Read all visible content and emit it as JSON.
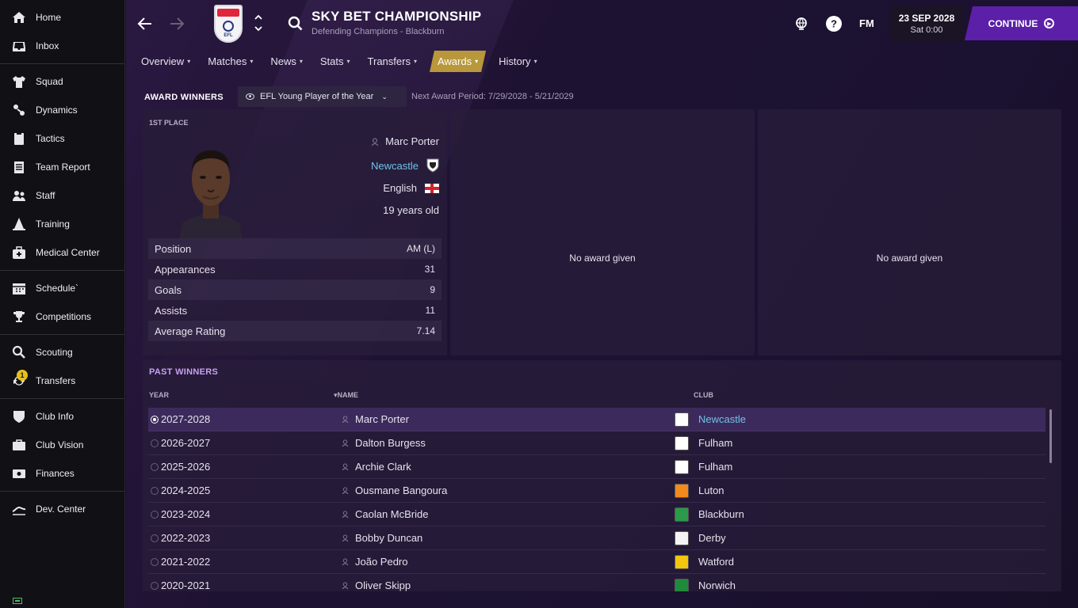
{
  "sidebar": {
    "groups": [
      [
        {
          "label": "Home",
          "icon": "home-icon"
        },
        {
          "label": "Inbox",
          "icon": "inbox-icon"
        }
      ],
      [
        {
          "label": "Squad",
          "icon": "shirt-icon"
        },
        {
          "label": "Dynamics",
          "icon": "dynamics-icon"
        },
        {
          "label": "Tactics",
          "icon": "tactics-board-icon"
        },
        {
          "label": "Team Report",
          "icon": "report-icon"
        },
        {
          "label": "Staff",
          "icon": "staff-icon"
        },
        {
          "label": "Training",
          "icon": "training-cone-icon"
        },
        {
          "label": "Medical Center",
          "icon": "medical-kit-icon"
        }
      ],
      [
        {
          "label": "Schedule`",
          "icon": "calendar-icon"
        },
        {
          "label": "Competitions",
          "icon": "trophy-icon"
        }
      ],
      [
        {
          "label": "Scouting",
          "icon": "magnifier-icon"
        },
        {
          "label": "Transfers",
          "icon": "transfers-icon",
          "badge": "1"
        }
      ],
      [
        {
          "label": "Club Info",
          "icon": "shield-icon"
        },
        {
          "label": "Club Vision",
          "icon": "briefcase-icon"
        },
        {
          "label": "Finances",
          "icon": "money-icon"
        }
      ],
      [
        {
          "label": "Dev. Center",
          "icon": "dev-center-icon"
        }
      ]
    ]
  },
  "header": {
    "title": "SKY BET CHAMPIONSHIP",
    "subtitle": "Defending Champions - Blackburn",
    "fm_label": "FM",
    "date": "23 SEP 2028",
    "time": "Sat 0:00",
    "continue_label": "CONTINUE"
  },
  "tabs": [
    {
      "label": "Overview",
      "active": false
    },
    {
      "label": "Matches",
      "active": false
    },
    {
      "label": "News",
      "active": false
    },
    {
      "label": "Stats",
      "active": false
    },
    {
      "label": "Transfers",
      "active": false
    },
    {
      "label": "Awards",
      "active": true
    },
    {
      "label": "History",
      "active": false
    }
  ],
  "award": {
    "section_title": "AWARD WINNERS",
    "selected_award": "EFL Young Player of the Year",
    "next_period": "Next Award Period: 7/29/2028 - 5/21/2029",
    "first_place_label": "1ST PLACE",
    "player": {
      "name": "Marc Porter",
      "club": "Newcastle",
      "nationality": "English",
      "age": "19 years old"
    },
    "stats": [
      {
        "label": "Position",
        "value": "AM (L)"
      },
      {
        "label": "Appearances",
        "value": "31"
      },
      {
        "label": "Goals",
        "value": "9"
      },
      {
        "label": "Assists",
        "value": "11"
      },
      {
        "label": "Average Rating",
        "value": "7.14"
      }
    ],
    "second_panel": "No award given",
    "third_panel": "No award given"
  },
  "past_winners": {
    "title": "PAST WINNERS",
    "columns": {
      "year": "YEAR",
      "name": "NAME",
      "club": "CLUB"
    },
    "rows": [
      {
        "year": "2027-2028",
        "name": "Marc Porter",
        "club": "Newcastle",
        "badge_color": "#ffffff",
        "selected": true,
        "club_link": true
      },
      {
        "year": "2026-2027",
        "name": "Dalton Burgess",
        "club": "Fulham",
        "badge_color": "#ffffff",
        "selected": false,
        "club_link": false
      },
      {
        "year": "2025-2026",
        "name": "Archie Clark",
        "club": "Fulham",
        "badge_color": "#ffffff",
        "selected": false,
        "club_link": false
      },
      {
        "year": "2024-2025",
        "name": "Ousmane Bangoura",
        "club": "Luton",
        "badge_color": "#f28a1e",
        "selected": false,
        "club_link": false
      },
      {
        "year": "2023-2024",
        "name": "Caolan McBride",
        "club": "Blackburn",
        "badge_color": "#2a9a4a",
        "selected": false,
        "club_link": false
      },
      {
        "year": "2022-2023",
        "name": "Bobby Duncan",
        "club": "Derby",
        "badge_color": "#f4f4f4",
        "selected": false,
        "club_link": false
      },
      {
        "year": "2021-2022",
        "name": "João Pedro",
        "club": "Watford",
        "badge_color": "#f2c70e",
        "selected": false,
        "club_link": false
      },
      {
        "year": "2020-2021",
        "name": "Oliver Skipp",
        "club": "Norwich",
        "badge_color": "#1f8a3c",
        "selected": false,
        "club_link": false
      }
    ]
  }
}
